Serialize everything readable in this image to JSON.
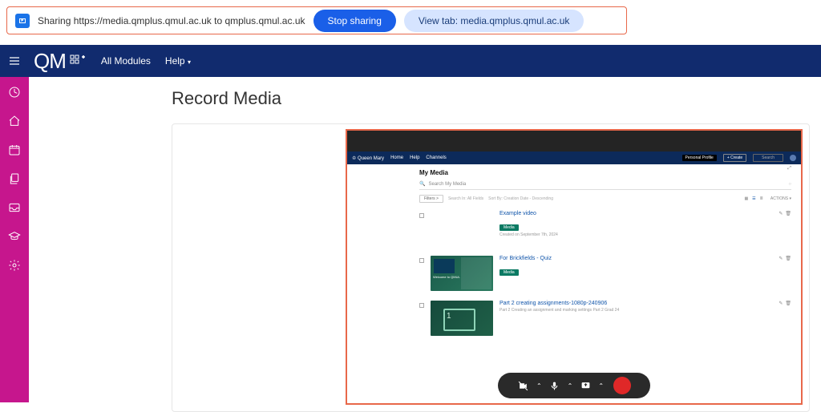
{
  "sharing_bar": {
    "text": "Sharing https://media.qmplus.qmul.ac.uk to qmplus.qmul.ac.uk",
    "stop_label": "Stop sharing",
    "view_label": "View tab: media.qmplus.qmul.ac.uk"
  },
  "app_bar": {
    "logo_main": "QM",
    "nav": {
      "all_modules": "All Modules",
      "help": "Help"
    }
  },
  "left_rail": {
    "items": [
      "dashboard-icon",
      "home-icon",
      "calendar-icon",
      "copy-icon",
      "inbox-icon",
      "graduation-icon",
      "gear-icon"
    ]
  },
  "page": {
    "title": "Record Media"
  },
  "preview": {
    "brand": "Queen Mary",
    "top_nav": [
      "Home",
      "Help",
      "Channels"
    ],
    "personal_profile_label": "Personal Profile",
    "create_label": "+ Create",
    "search_placeholder": "Search",
    "section_title": "My Media",
    "search_label": "Search My Media",
    "filters_label": "Filters",
    "search_in_label": "Search In: All Fields",
    "sort_label": "Sort By: Creation Date - Descending",
    "actions_label": "ACTIONS",
    "media_items": [
      {
        "title": "Example video",
        "tag": "Media",
        "date": "Created on September 7th, 2024",
        "thumb_class": ""
      },
      {
        "title": "For Brickfields - Quiz",
        "tag": "Media",
        "date": "",
        "thumb_class": "t2",
        "welcome": "Welcome to QMUL"
      },
      {
        "title": "Part 2 creating assignments-1080p-240906",
        "sub": "Part 2 Creating an assignment and marking settings Part 2 Grad 24",
        "thumb_class": "t3"
      }
    ]
  }
}
